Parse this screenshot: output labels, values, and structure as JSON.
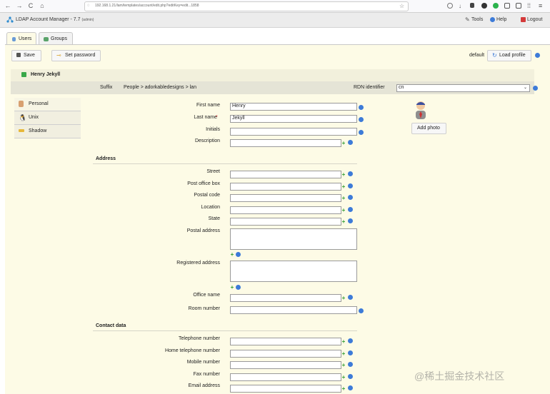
{
  "browser": {
    "url": "192.168.1.21/lam/templates/account/edit.php?editKey=edit...1858",
    "nav": {
      "back": "←",
      "forward": "→",
      "reload": "C",
      "home": "⌂"
    }
  },
  "header": {
    "title": "LDAP Account Manager - 7.7",
    "user": "(admin)",
    "links": {
      "tools": "Tools",
      "help": "Help",
      "logout": "Logout"
    }
  },
  "tabs": [
    {
      "label": "Users"
    },
    {
      "label": "Groups"
    }
  ],
  "toolbar": {
    "save": "Save",
    "set_password": "Set password",
    "profile_name": "default",
    "load_profile": "Load profile"
  },
  "account": {
    "name": "Henry Jekyll",
    "suffix_label": "Suffix",
    "suffix_value": "People > adorkabledesigns > lan",
    "rdn_label": "RDN identifier",
    "rdn_value": "cn"
  },
  "sidebar": [
    {
      "label": "Personal"
    },
    {
      "label": "Unix"
    },
    {
      "label": "Shadow"
    }
  ],
  "photo": {
    "add": "Add photo"
  },
  "personal": {
    "first_name": {
      "label": "First name",
      "value": "Henry"
    },
    "last_name": {
      "label": "Last name",
      "value": "Jekyll",
      "required": "*"
    },
    "initials": {
      "label": "Initials",
      "value": ""
    },
    "description": {
      "label": "Description",
      "value": ""
    }
  },
  "address": {
    "title": "Address",
    "street": "Street",
    "po_box": "Post office box",
    "postal_code": "Postal code",
    "location": "Location",
    "state": "State",
    "postal_address": "Postal address",
    "registered_address": "Registered address",
    "office_name": "Office name",
    "room_number": "Room number"
  },
  "contact": {
    "title": "Contact data",
    "telephone": "Telephone number",
    "home_telephone": "Home telephone number",
    "mobile": "Mobile number",
    "fax": "Fax number",
    "email": "Email address"
  },
  "watermark": "@稀土掘金技术社区"
}
